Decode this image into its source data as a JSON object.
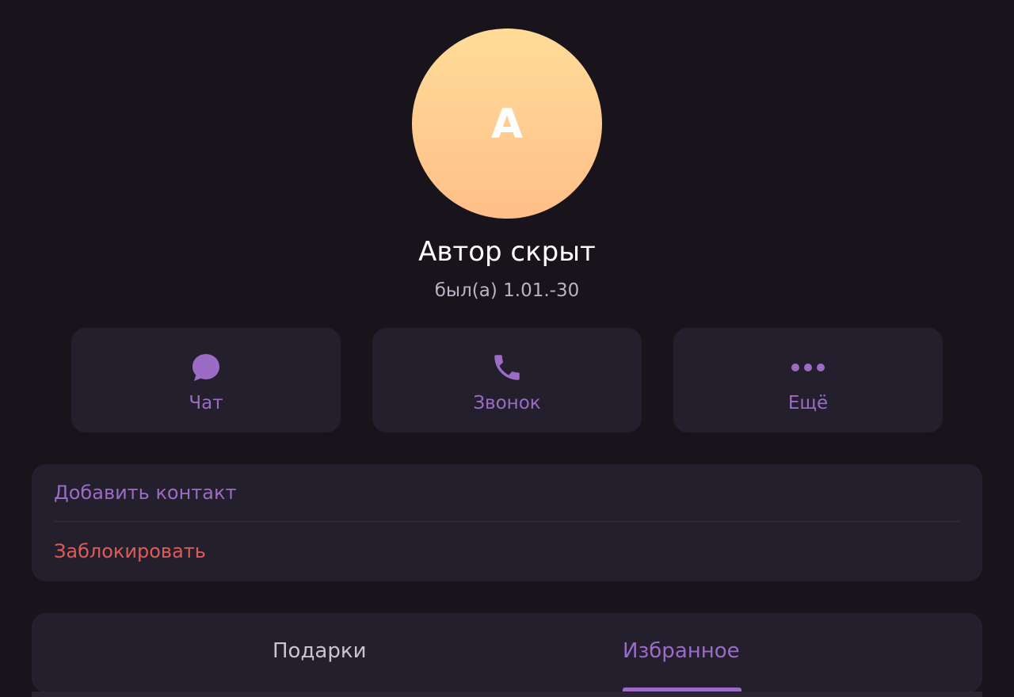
{
  "profile": {
    "avatar_letter": "A",
    "name": "Автор скрыт",
    "status": "был(а) 1.01.-30"
  },
  "actions": {
    "chat_label": "Чат",
    "call_label": "Звонок",
    "more_label": "Ещё",
    "chat_icon": "chat-bubble-icon",
    "call_icon": "phone-icon",
    "more_icon": "more-dots-icon"
  },
  "contact": {
    "add_label": "Добавить контакт",
    "block_label": "Заблокировать"
  },
  "tabs": [
    {
      "label": "Подарки",
      "active": false
    },
    {
      "label": "Избранное",
      "active": true
    }
  ],
  "colors": {
    "accent": "#9b6bc6",
    "danger": "#e05a58",
    "background": "#19141c",
    "card": "#241f2c",
    "avatar_gradient_top": "#ffdc98",
    "avatar_gradient_bottom": "#ffbf88"
  }
}
